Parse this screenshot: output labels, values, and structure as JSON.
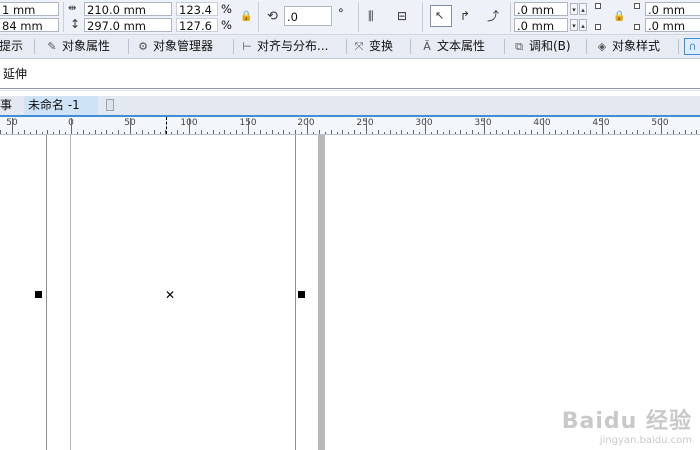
{
  "propbar": {
    "pos_x": "1 mm",
    "pos_y": "84 mm",
    "width": "210.0 mm",
    "height": "297.0 mm",
    "scale_x": "123.4",
    "scale_y": "127.6",
    "pct": "%",
    "angle": ".0",
    "deg": "°",
    "corner_1": ".0 mm",
    "corner_2": ".0 mm",
    "corner_3": ".0 mm",
    "corner_4": ".0 mm"
  },
  "docker_tabs": [
    {
      "label": "提示",
      "icon": "hint-icon"
    },
    {
      "label": "对象属性",
      "icon": "object-properties-icon"
    },
    {
      "label": "对象管理器",
      "icon": "object-manager-icon"
    },
    {
      "label": "对齐与分布...",
      "icon": "align-distribute-icon"
    },
    {
      "label": "变换",
      "icon": "transform-icon"
    },
    {
      "label": "文本属性",
      "icon": "text-properties-icon"
    },
    {
      "label": "调和(B)",
      "icon": "blend-icon"
    },
    {
      "label": "对象样式",
      "icon": "object-styles-icon"
    }
  ],
  "secondary_bar": {
    "label": "延伸"
  },
  "doc_tabs": {
    "prev": "事",
    "active": "未命名 -1"
  },
  "ruler": {
    "labels": [
      "50",
      "0",
      "50",
      "100",
      "150",
      "200",
      "250",
      "300",
      "350",
      "400",
      "450",
      "500"
    ]
  },
  "watermark": {
    "logo": "Baidu 经验",
    "url": "jingyan.baidu.com"
  },
  "colors": {
    "accent": "#3f8fd6",
    "toolbar_bg": "#eef2f8",
    "tab_bg": "#e7ecf4"
  }
}
